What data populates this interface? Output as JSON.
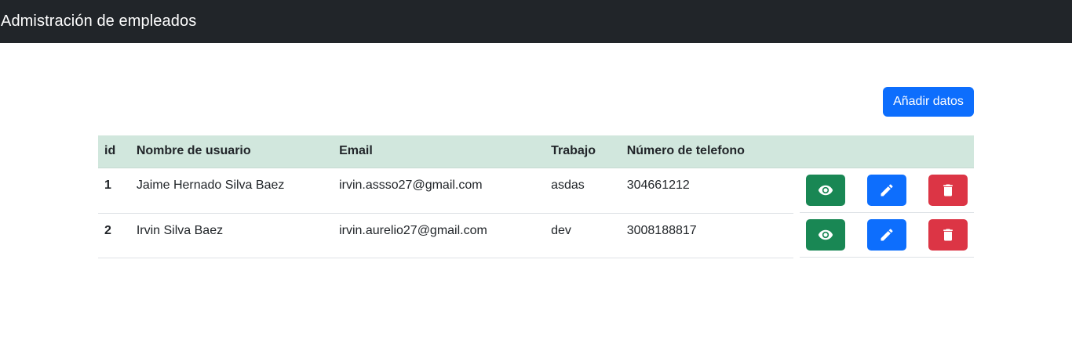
{
  "navbar": {
    "brand": "Admistración de empleados"
  },
  "toolbar": {
    "add_label": "Añadir datos"
  },
  "table": {
    "headers": [
      "id",
      "Nombre de usuario",
      "Email",
      "Trabajo",
      "Número de telefono",
      ""
    ],
    "rows": [
      {
        "id": "1",
        "name": "Jaime Hernado Silva Baez",
        "email": "irvin.assso27@gmail.com",
        "job": "asdas",
        "phone": "304661212"
      },
      {
        "id": "2",
        "name": "Irvin Silva Baez",
        "email": "irvin.aurelio27@gmail.com",
        "job": "dev",
        "phone": "3008188817"
      }
    ]
  },
  "icons": {
    "view": "eye-icon",
    "edit": "pencil-icon",
    "delete": "trash-icon"
  },
  "colors": {
    "navbar": "#212529",
    "primary": "#0d6efd",
    "success": "#198754",
    "danger": "#dc3545",
    "header_row": "#d1e7dd"
  }
}
